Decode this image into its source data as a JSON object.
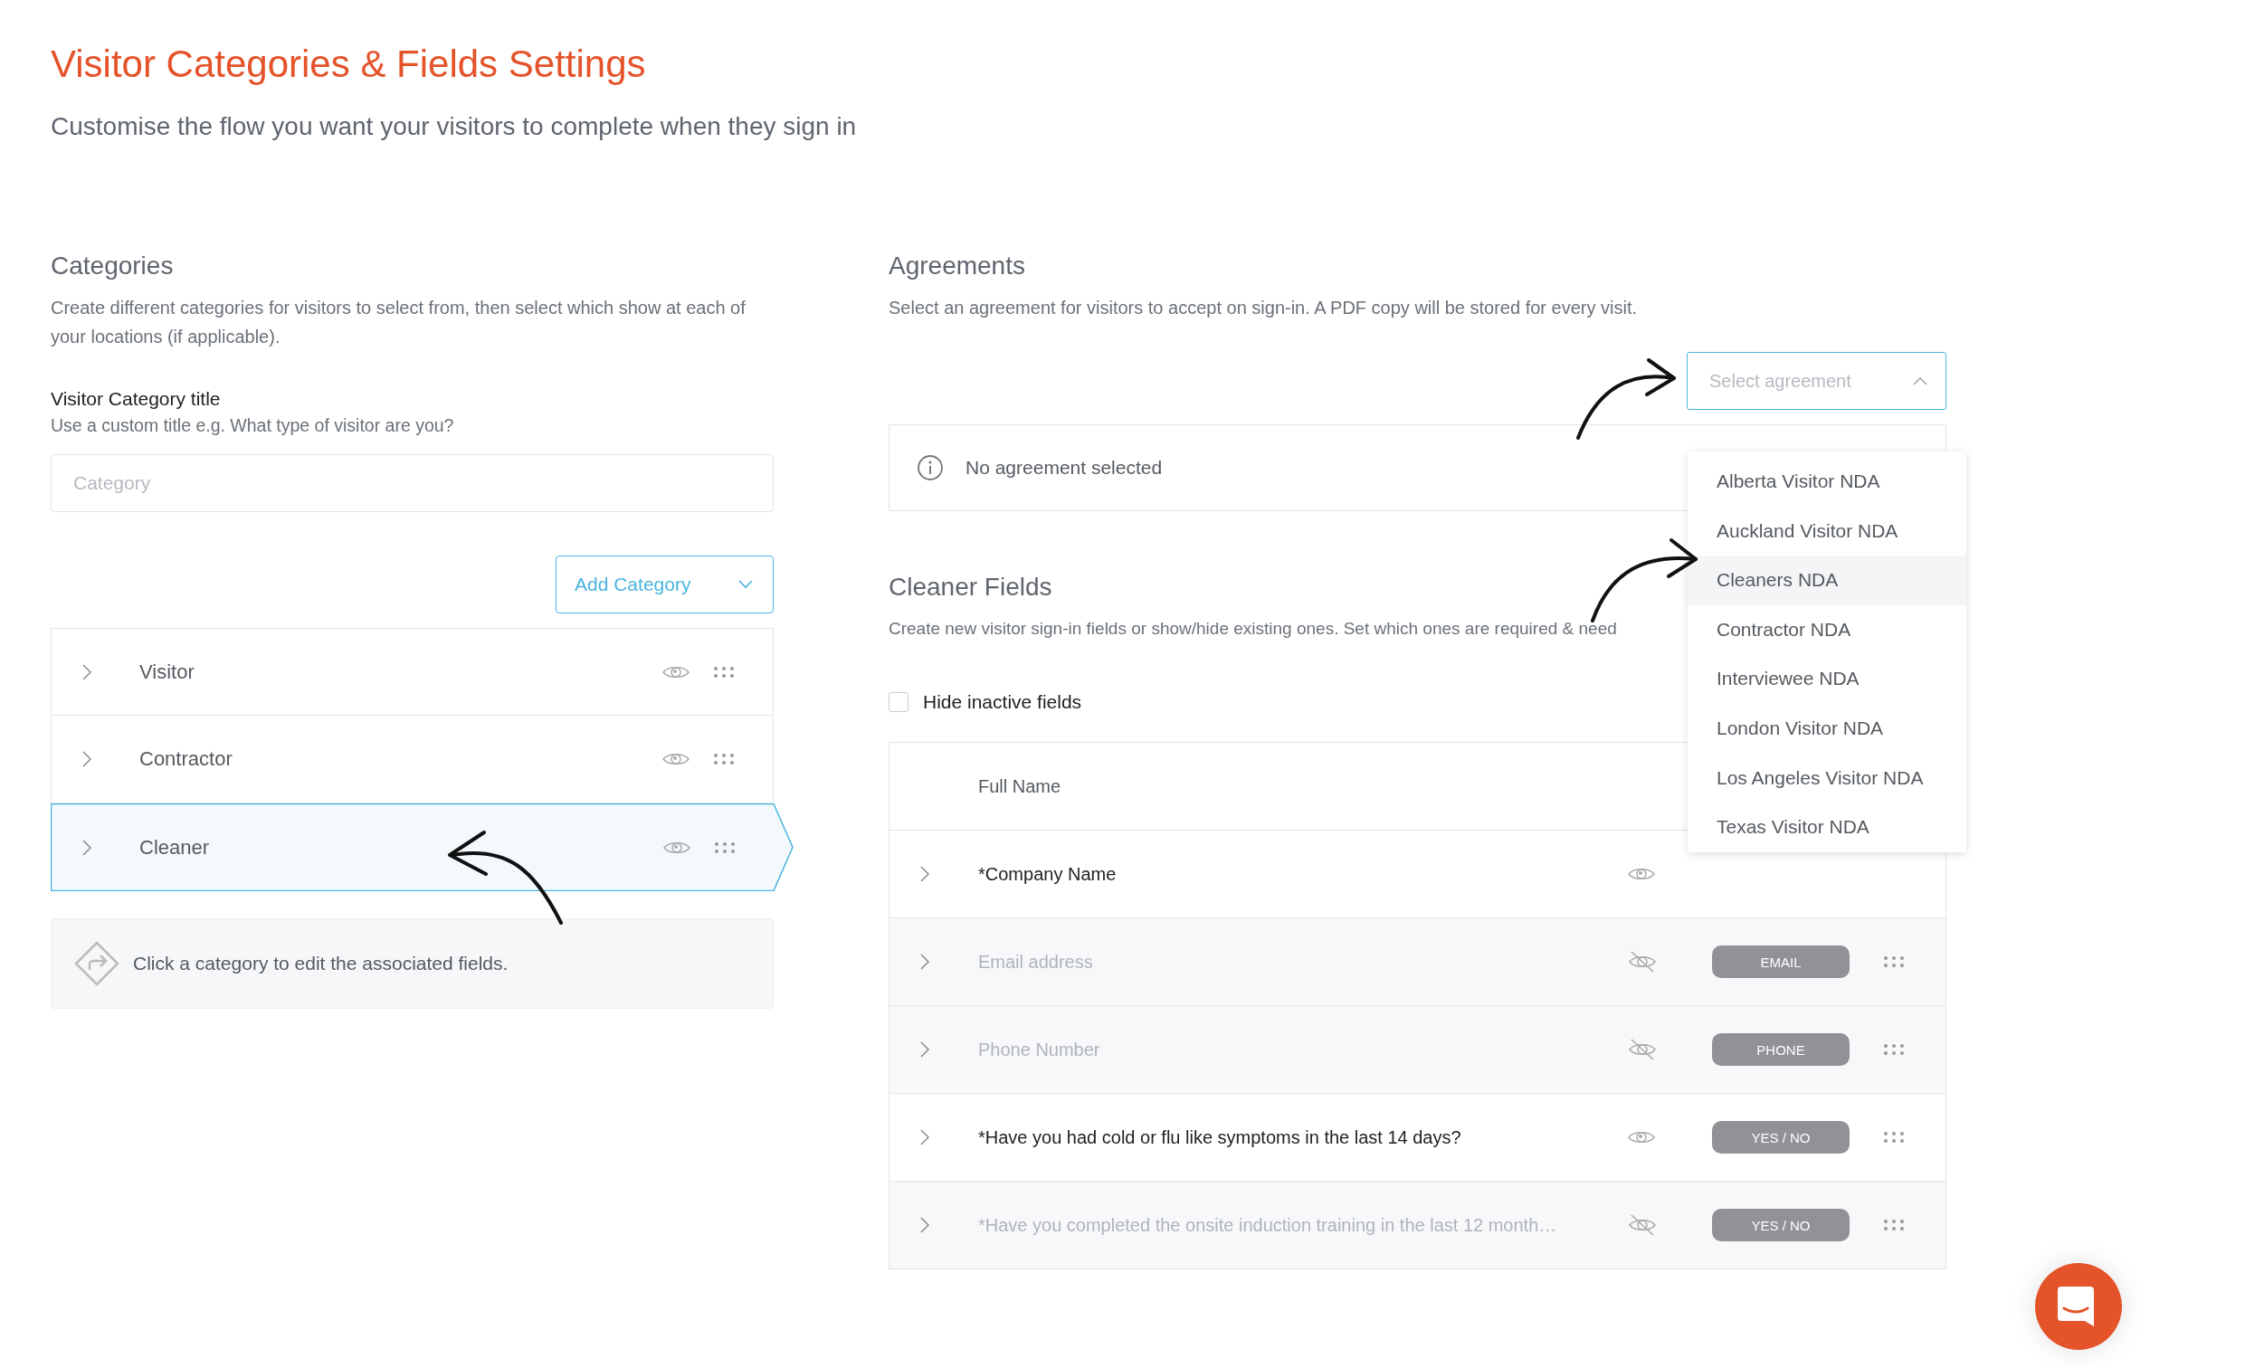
{
  "page": {
    "title": "Visitor Categories & Fields Settings",
    "subtitle": "Customise the flow you want your visitors to complete when they sign in"
  },
  "categories": {
    "heading": "Categories",
    "description": "Create different categories for visitors to select from, then select which show at each of your locations (if applicable).",
    "title_label": "Visitor Category title",
    "title_hint": "Use a custom title e.g. What type of visitor are you?",
    "input": {
      "placeholder": "Category"
    },
    "add_button": "Add Category",
    "rows": [
      {
        "name": "Visitor",
        "selected": false
      },
      {
        "name": "Contractor",
        "selected": false
      },
      {
        "name": "Cleaner",
        "selected": true
      }
    ],
    "hint": "Click a category to edit the associated fields."
  },
  "agreements": {
    "heading": "Agreements",
    "description": "Select an agreement for visitors to accept on sign-in. A PDF copy will be stored for every visit.",
    "select": {
      "placeholder": "Select agreement",
      "expanded": true
    },
    "status": "No agreement selected",
    "options": [
      {
        "label": "Alberta Visitor NDA",
        "selected": false
      },
      {
        "label": "Auckland Visitor NDA",
        "selected": false
      },
      {
        "label": "Cleaners NDA",
        "selected": true
      },
      {
        "label": "Contractor NDA",
        "selected": false
      },
      {
        "label": "Interviewee NDA",
        "selected": false
      },
      {
        "label": "London Visitor NDA",
        "selected": false
      },
      {
        "label": "Los Angeles Visitor NDA",
        "selected": false
      },
      {
        "label": "Texas Visitor NDA",
        "selected": false
      }
    ]
  },
  "fields": {
    "heading": "Cleaner Fields",
    "description": "Create new visitor sign-in fields or show/hide existing ones. Set which ones are required & need",
    "hide_inactive": {
      "label": "Hide inactive fields",
      "checked": false
    },
    "rows": [
      {
        "kind": "header",
        "label": "Full Name"
      },
      {
        "kind": "field",
        "label": "*Company Name",
        "visible": true,
        "draggable": false
      },
      {
        "kind": "field",
        "label": "Email address",
        "visible": false,
        "badge": "EMAIL",
        "draggable": true
      },
      {
        "kind": "field",
        "label": "Phone Number",
        "visible": false,
        "badge": "PHONE",
        "draggable": true
      },
      {
        "kind": "field",
        "label": "*Have you had cold or flu like symptoms in the last 14 days?",
        "visible": true,
        "badge": "YES / NO",
        "draggable": true
      },
      {
        "kind": "field",
        "label": "*Have you completed the onsite induction training in the last 12 month…",
        "visible": false,
        "badge": "YES / NO",
        "draggable": true
      }
    ]
  }
}
